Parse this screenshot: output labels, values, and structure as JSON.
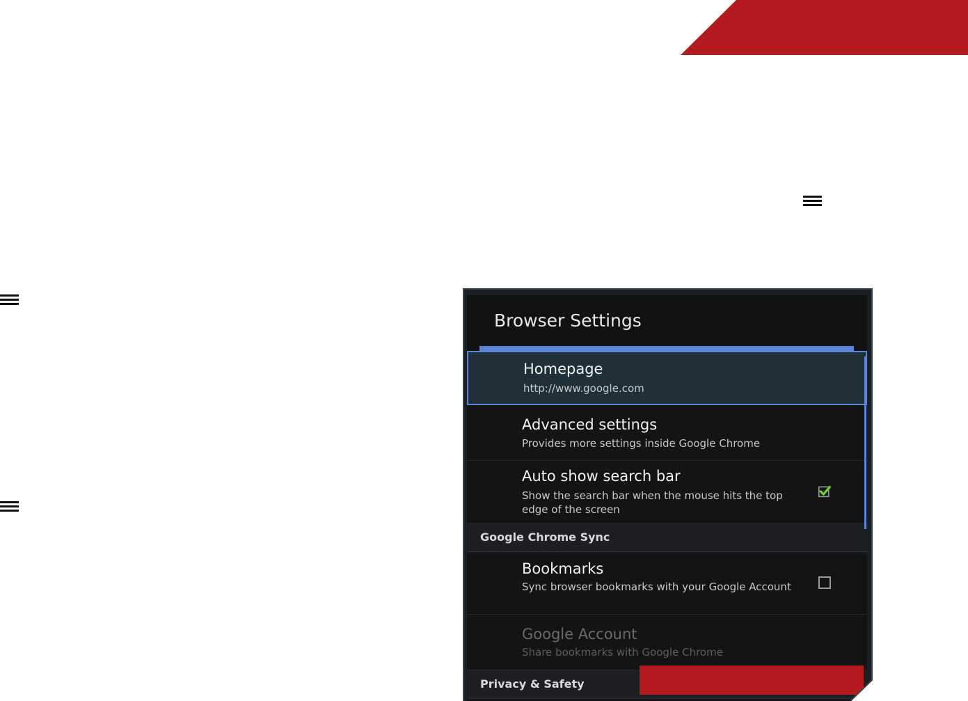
{
  "colors": {
    "banner": "#b31b1f",
    "accent": "#5b86d8",
    "check": "#6fd12a"
  },
  "icons": {
    "menu": "hamburger-menu-icon",
    "checkbox_checked": "checkbox-checked-icon",
    "checkbox_empty": "checkbox-empty-icon"
  },
  "settings": {
    "title": "Browser Settings",
    "homepage": {
      "title": "Homepage",
      "subtitle": "http://www.google.com"
    },
    "advanced": {
      "title": "Advanced settings",
      "subtitle": "Provides more settings inside Google Chrome"
    },
    "auto_search": {
      "title": "Auto show search bar",
      "subtitle": "Show the search bar when the mouse hits the top edge of the screen",
      "checked": true
    },
    "sync_header": "Google Chrome Sync",
    "bookmarks": {
      "title": "Bookmarks",
      "subtitle": "Sync browser bookmarks with your Google Account",
      "checked": false
    },
    "google_account": {
      "title": "Google Account",
      "subtitle": "Share bookmarks with Google Chrome",
      "disabled": true
    },
    "privacy_header": "Privacy & Safety"
  }
}
